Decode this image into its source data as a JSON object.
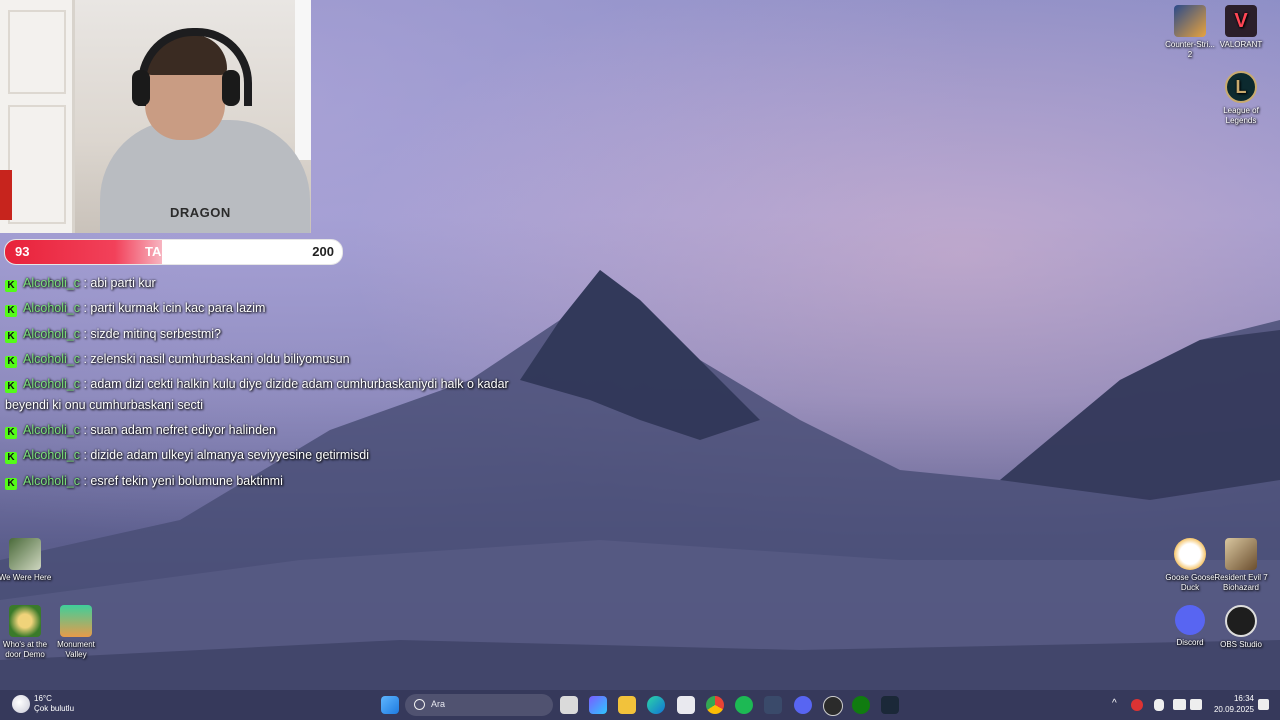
{
  "overlay": {
    "follow_goal": {
      "current": "93",
      "label": "TAKIPSS",
      "target": "200",
      "progress": 0.465
    },
    "webcam": {
      "shirt_text": "DRAGON"
    }
  },
  "chat": {
    "badge": "K",
    "messages": [
      {
        "user": "Alcoholi_c",
        "text": " : abi parti kur"
      },
      {
        "user": "Alcoholi_c",
        "text": " : parti kurmak icin kac para lazim"
      },
      {
        "user": "Alcoholi_c",
        "text": " : sizde mitinq serbestmi?"
      },
      {
        "user": "Alcoholi_c",
        "text": " : zelenski nasil cumhurbaskani oldu biliyomusun"
      },
      {
        "user": "Alcoholi_c",
        "text": " : adam dizi cekti halkin kulu diye dizide adam cumhurbaskaniydi halk o kadar beyendi ki onu cumhurbaskani secti"
      },
      {
        "user": "Alcoholi_c",
        "text": " : suan adam nefret ediyor halinden"
      },
      {
        "user": "Alcoholi_c",
        "text": " : dizide adam ulkeyi almanya seviyyesine getirmisdi"
      },
      {
        "user": "Alcoholi_c",
        "text": " : esref tekin yeni bolumune baktinmi"
      }
    ]
  },
  "desktop_icons": {
    "counter_strike": "Counter-Stri... 2",
    "valorant": "VALORANT",
    "league": "League of Legends",
    "we_were_here": "We Were Here",
    "whos_at_door": "Who's at the door Demo",
    "monument_valley": "Monument Valley",
    "goose_goose_duck": "Goose Goose Duck",
    "resident_evil": "Resident Evil 7 Biohazard",
    "discord": "Discord",
    "obs": "OBS Studio"
  },
  "taskbar": {
    "weather_temp": "16°C",
    "weather_desc": "Çok bulutlu",
    "search_placeholder": "Ara",
    "time": "16:34",
    "date": "20.09.2025"
  },
  "colors": {
    "accent_red": "#e8223a",
    "kick_green": "#53fc18",
    "username_green": "#7be07b"
  }
}
